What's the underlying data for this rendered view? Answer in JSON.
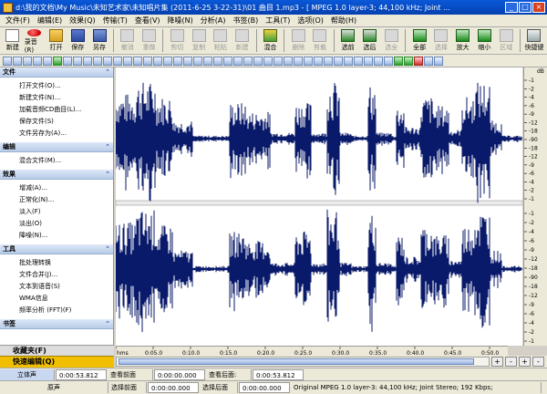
{
  "window": {
    "title": "d:\\我的文档\\My Music\\未知艺术家\\未知唱片集 (2011-6-25 3-22-31)\\01 曲目 1.mp3 - [ MPEG 1.0 layer-3; 44,100 kHz; Joint ...",
    "min": "_",
    "max": "□",
    "close": "×"
  },
  "menu": [
    "文件(F)",
    "编辑(E)",
    "效果(Q)",
    "传输(T)",
    "查看(V)",
    "降噪(N)",
    "分析(A)",
    "书签(B)",
    "工具(T)",
    "选项(O)",
    "帮助(H)"
  ],
  "toolbar": [
    {
      "label": "新建",
      "icon": "new-file-icon",
      "dis": false
    },
    {
      "label": "录音(R)",
      "icon": "record-icon",
      "dis": false
    },
    {
      "label": "打开",
      "icon": "open-folder-icon",
      "dis": false
    },
    {
      "label": "保存",
      "icon": "save-icon",
      "dis": false
    },
    {
      "label": "另存",
      "icon": "save-as-icon",
      "dis": false
    },
    {
      "label": "撤消",
      "icon": "undo-icon",
      "dis": true
    },
    {
      "label": "重做",
      "icon": "redo-icon",
      "dis": true
    },
    {
      "label": "剪切",
      "icon": "cut-icon",
      "dis": true
    },
    {
      "label": "复制",
      "icon": "copy-icon",
      "dis": true
    },
    {
      "label": "粘贴",
      "icon": "paste-icon",
      "dis": true
    },
    {
      "label": "新建",
      "icon": "paste-new-icon",
      "dis": true
    },
    {
      "label": "混合",
      "icon": "mix-icon",
      "dis": false
    },
    {
      "label": "删除",
      "icon": "delete-icon",
      "dis": true
    },
    {
      "label": "剪裁",
      "icon": "trim-icon",
      "dis": true
    },
    {
      "label": "选前",
      "icon": "select-before-icon",
      "dis": false
    },
    {
      "label": "选后",
      "icon": "select-after-icon",
      "dis": false
    },
    {
      "label": "选全",
      "icon": "select-all-icon",
      "dis": true
    },
    {
      "label": "全部",
      "icon": "zoom-all-icon",
      "dis": false
    },
    {
      "label": "选择",
      "icon": "zoom-select-icon",
      "dis": true
    },
    {
      "label": "放大",
      "icon": "zoom-in-icon",
      "dis": false
    },
    {
      "label": "缩小",
      "icon": "zoom-out-icon",
      "dis": false
    },
    {
      "label": "区域",
      "icon": "region-icon",
      "dis": true
    },
    {
      "label": "快捷键",
      "icon": "shortcut-icon",
      "dis": false
    }
  ],
  "sidebar": {
    "sections": [
      {
        "title": "文件",
        "items": [
          {
            "label": "打开文件(O)...",
            "dis": false
          },
          {
            "label": "新建文件(N)...",
            "dis": false
          },
          {
            "label": "加载音频CD曲目(L)...",
            "dis": false
          },
          {
            "label": "保存文件(S)",
            "dis": false
          },
          {
            "label": "文件另存为(A)...",
            "dis": false
          }
        ]
      },
      {
        "title": "编辑",
        "items": [
          {
            "label": "混合文件(M)...",
            "dis": false
          }
        ]
      },
      {
        "title": "效果",
        "items": [
          {
            "label": "增减(A)...",
            "dis": false
          },
          {
            "label": "正常化(N)...",
            "dis": false
          },
          {
            "label": "淡入(F)",
            "dis": false
          },
          {
            "label": "淡出(O)",
            "dis": false
          },
          {
            "label": "降噪(N)...",
            "dis": false
          }
        ]
      },
      {
        "title": "工具",
        "items": [
          {
            "label": "批处理转换",
            "dis": false
          },
          {
            "label": "文件合并(J)...",
            "dis": false
          },
          {
            "label": "文本到语音(S)",
            "dis": false
          },
          {
            "label": "WMA信息",
            "dis": false
          },
          {
            "label": "频率分析 (FFT)(F)",
            "dis": false
          }
        ]
      },
      {
        "title": "书签",
        "items": []
      }
    ],
    "bottom1": "收藏夹(F)",
    "bottom2": "快速编辑(Q)"
  },
  "ruler": {
    "unit": "dB",
    "labels": [
      "-1",
      "-2",
      "-4",
      "-6",
      "-9",
      "-12",
      "-18",
      "-90",
      "-18",
      "-12",
      "-9",
      "-6",
      "-4",
      "-2",
      "-1"
    ]
  },
  "timeline": {
    "labels": [
      "hms",
      "0:05.0",
      "0:10.0",
      "0:15.0",
      "0:20.0",
      "0:25.0",
      "0:30.0",
      "0:35.0",
      "0:40.0",
      "0:45.0",
      "0:50.0"
    ]
  },
  "status": {
    "row1": {
      "mode": "立体声",
      "length": "0:00:53.812",
      "view_start_label": "查看前面",
      "view_start": "0:00:00.000",
      "view_end_label": "查看后面:",
      "view_end": "0:00:53.812"
    },
    "row2": {
      "channel": "原声",
      "sel_start_label": "选择前面",
      "sel_start": "0:00:00.000",
      "sel_end_label": "选择后面",
      "sel_end": "0:00:00.000",
      "format": "Original  MPEG 1.0 layer-3: 44,100 kHz; Joint Stereo; 192 Kbps;"
    }
  },
  "colors": {
    "waveform": "#0a1a6a",
    "title_bar": "#0a58d8",
    "record": "#e01010"
  }
}
